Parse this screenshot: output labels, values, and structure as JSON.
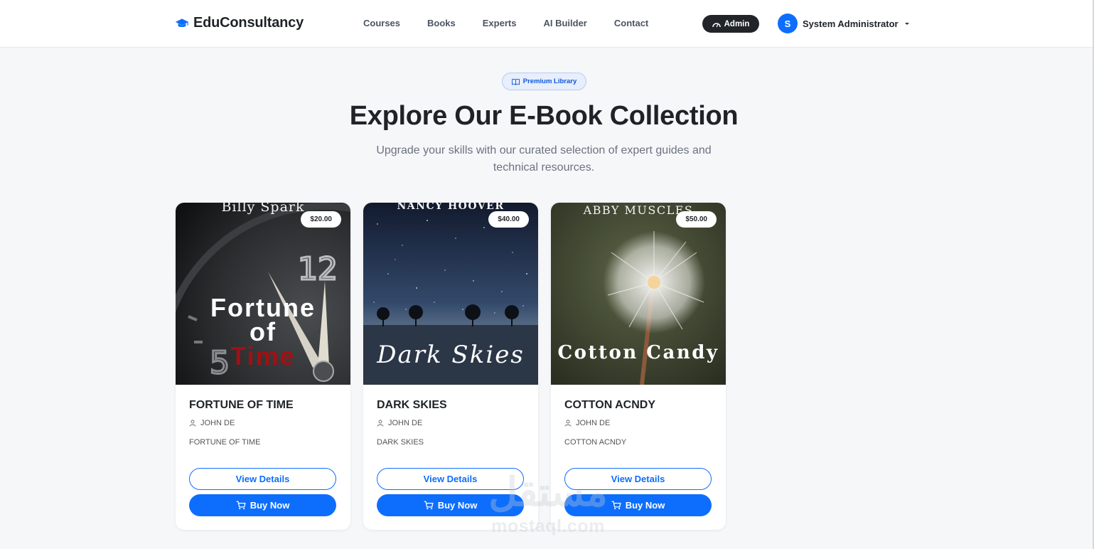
{
  "app": {
    "brand": "EduConsultancy",
    "accent_color": "#0d6efd"
  },
  "nav": {
    "links": [
      "Courses",
      "Books",
      "Experts",
      "AI Builder",
      "Contact"
    ],
    "admin_label": "Admin",
    "user_initial": "S",
    "user_name": "System Administrator"
  },
  "hero": {
    "badge": "Premium Library",
    "title": "Explore Our E-Book Collection",
    "subtitle": "Upgrade your skills with our curated selection of expert guides and technical resources."
  },
  "books": [
    {
      "cover_author": "Billy Spark",
      "cover_title_line1": "Fortune",
      "cover_title_line2": "of",
      "cover_title_line3": "Time",
      "price": "$20.00",
      "title": "FORTUNE OF TIME",
      "author": "JOHN DE",
      "description": "FORTUNE OF TIME"
    },
    {
      "cover_author": "NANCY HOOVER",
      "cover_title": "Dark Skies",
      "price": "$40.00",
      "title": "DARK SKIES",
      "author": "JOHN DE",
      "description": "DARK SKIES"
    },
    {
      "cover_author": "ABBY MUSCLES",
      "cover_title": "Cotton Candy",
      "price": "$50.00",
      "title": "COTTON ACNDY",
      "author": "JOHN DE",
      "description": "COTTON ACNDY"
    }
  ],
  "buttons": {
    "view_details": "View Details",
    "buy_now": "Buy Now"
  },
  "watermark": {
    "arabic": "مستقل",
    "latin": "mostaql.com"
  }
}
